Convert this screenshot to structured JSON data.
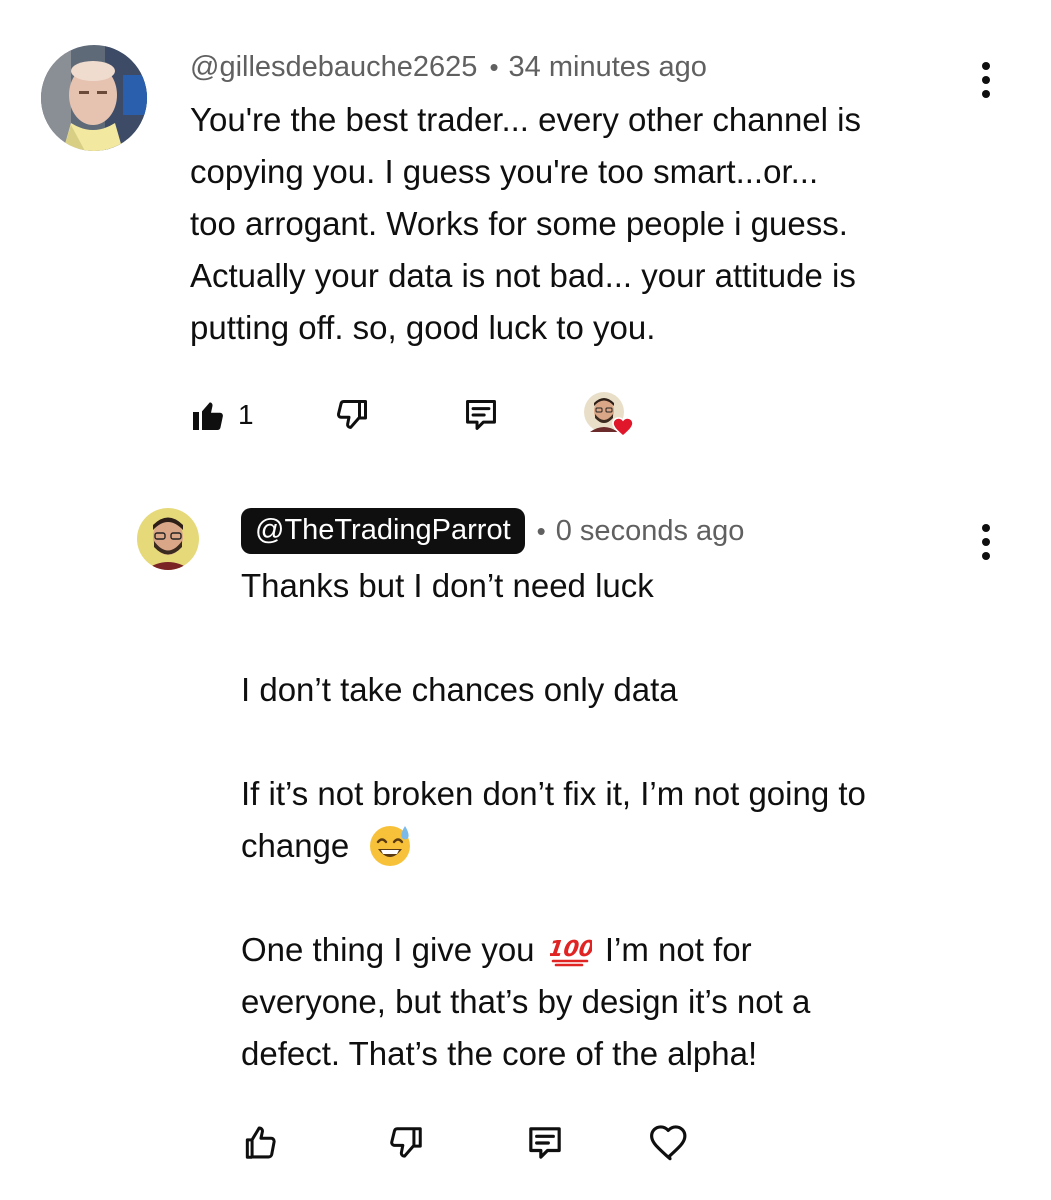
{
  "comments": [
    {
      "author": "@gillesdebauche2625",
      "separator": "•",
      "timestamp": "34 minutes ago",
      "lines": [
        "You're the best trader... every other channel is",
        "copying you. I guess you're too smart...or...",
        "too arrogant. Works for some people i guess.",
        "Actually your data is not bad... your attitude is",
        "putting off. so, good luck to you."
      ],
      "like_count": "1",
      "liked": true,
      "creator_hearted": true
    },
    {
      "author": "@TheTradingParrot",
      "is_channel_owner": true,
      "separator": "•",
      "timestamp": "0 seconds ago",
      "paragraphs": [
        "Thanks but I don’t need luck",
        "I don’t take chances only data",
        "If it’s not broken don’t fix it, I’m not going to",
        "change",
        "One thing I give you",
        "I’m not for",
        "everyone, but that’s by design it’s not a",
        "defect. That’s the core of the alpha!"
      ],
      "emojis": [
        "sweat-smile-emoji",
        "hundred-points-emoji"
      ]
    }
  ],
  "icons": {
    "like": "thumbs-up-icon",
    "dislike": "thumbs-down-icon",
    "reply": "reply-icon",
    "heart": "heart-icon",
    "menu": "more-vert-icon"
  },
  "colors": {
    "text": "#0f0f0f",
    "secondary": "#606060",
    "owner_badge_bg": "#0f0f0f",
    "heart": "#e0162b"
  }
}
